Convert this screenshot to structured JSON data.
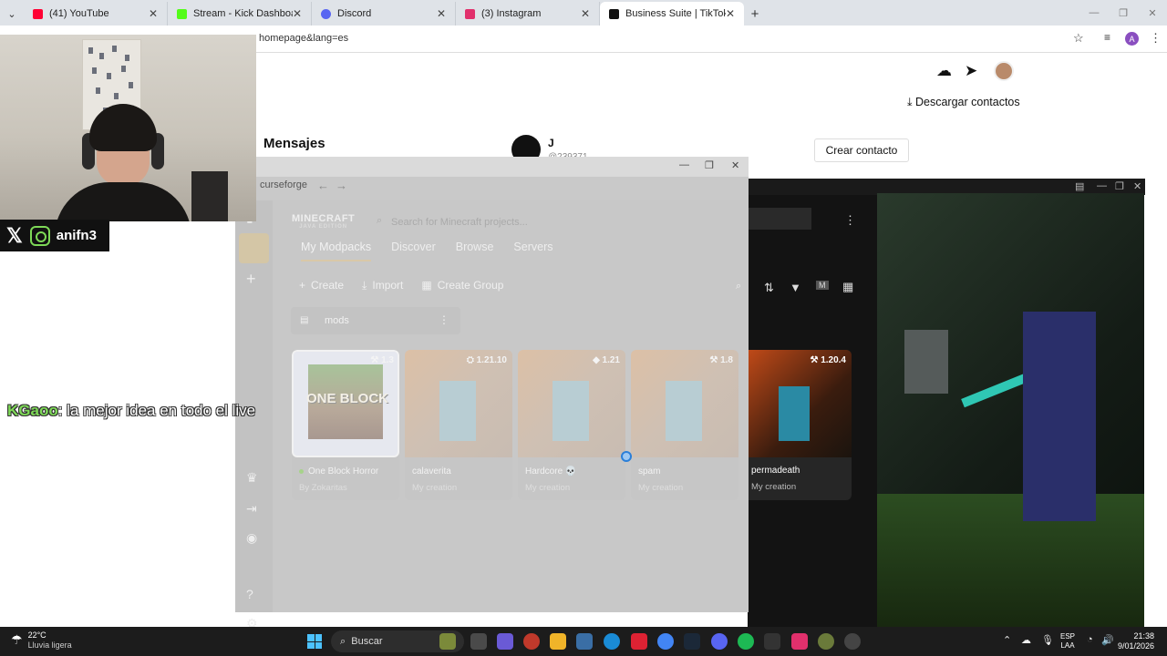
{
  "browser": {
    "tabs": [
      {
        "title": "(41) YouTube",
        "color": "#ff0033"
      },
      {
        "title": "Stream - Kick Dashboard",
        "color": "#53fc18"
      },
      {
        "title": "Discord",
        "color": "#5865f2"
      },
      {
        "title": "(3) Instagram",
        "color": "#e1306c"
      },
      {
        "title": "Business Suite | TikTok",
        "color": "#111111"
      }
    ],
    "url": "homepage&lang=es",
    "profile_initial": "A"
  },
  "tiktok": {
    "download_contacts": "Descargar contactos",
    "messages_title": "Mensajes",
    "contact_name": "J",
    "contact_handle": "@239371",
    "create_contact": "Crear contacto"
  },
  "overlay": {
    "social_handle": "anifn3",
    "chat_user": "KGaoo",
    "chat_message": ": la mejor idea en todo el live"
  },
  "curseforge": {
    "app_name": "curseforge",
    "logo_text": "MINECRAFT",
    "logo_sub": "JAVA EDITION",
    "search_placeholder": "Search for Minecraft projects...",
    "tabs": [
      "My Modpacks",
      "Discover",
      "Browse",
      "Servers"
    ],
    "actions": {
      "create": "Create",
      "import": "Import",
      "create_group": "Create Group"
    },
    "group_name": "mods",
    "cards": [
      {
        "name": "One Block Horror",
        "by": "By Zokaritas",
        "version": "1.3",
        "art_text": "ONE BLOCK"
      },
      {
        "name": "calaverita",
        "by": "My creation",
        "version": "1.21.10"
      },
      {
        "name": "Hardcore 💀",
        "by": "My creation",
        "version": "1.21"
      },
      {
        "name": "spam",
        "by": "My creation",
        "version": "1.8"
      },
      {
        "name": "permadeath",
        "by": "My creation",
        "version": "1.20.4"
      }
    ]
  },
  "taskbar": {
    "temperature": "22°C",
    "weather": "Lluvia ligera",
    "search": "Buscar",
    "lang1": "ESP",
    "lang2": "LAA",
    "time": "21:38",
    "date": "9/01/2026"
  }
}
